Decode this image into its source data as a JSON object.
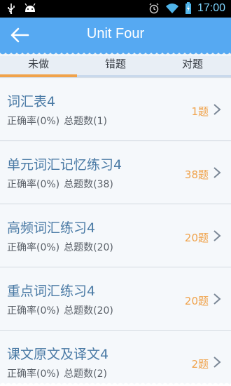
{
  "status_bar": {
    "time": "17:00",
    "icons": [
      "usb-icon",
      "android-icon",
      "alarm-icon",
      "wifi-icon",
      "battery-charging-icon"
    ]
  },
  "header": {
    "title": "Unit Four",
    "back_icon": "arrow-left-icon"
  },
  "tabs": [
    {
      "label": "未做",
      "active": true
    },
    {
      "label": "错题",
      "active": false
    },
    {
      "label": "对题",
      "active": false
    }
  ],
  "items": [
    {
      "title": "词汇表4",
      "accuracy": "正确率(0%)",
      "total": "总题数(1)",
      "count": "1题"
    },
    {
      "title": "单元词汇记忆练习4",
      "accuracy": "正确率(0%)",
      "total": "总题数(38)",
      "count": "38题"
    },
    {
      "title": "高频词汇练习4",
      "accuracy": "正确率(0%)",
      "total": "总题数(20)",
      "count": "20题"
    },
    {
      "title": "重点词汇练习4",
      "accuracy": "正确率(0%)",
      "total": "总题数(20)",
      "count": "20题"
    },
    {
      "title": "课文原文及译文4",
      "accuracy": "正确率(0%)",
      "total": "总题数(2)",
      "count": "2题"
    }
  ],
  "colors": {
    "header": "#56a9f2",
    "accent": "#f0a24a",
    "title_text": "#4a7aa5"
  }
}
